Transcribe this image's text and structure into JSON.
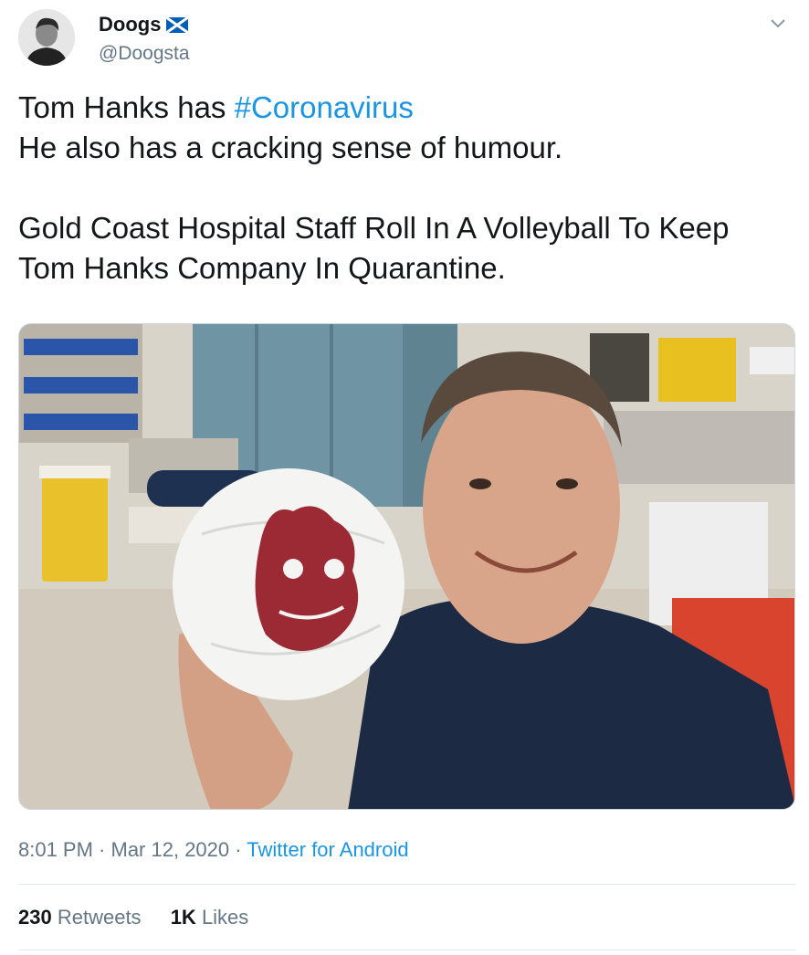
{
  "user": {
    "display_name": "Doogs",
    "handle": "@Doogsta",
    "flag_icon": "scotland-flag-icon"
  },
  "menu_icon": "chevron-down-icon",
  "tweet": {
    "line1_text": "Tom Hanks has ",
    "line1_hashtag": "#Coronavirus",
    "line2": "He also has a cracking sense of humour.",
    "line3": "Gold Coast Hospital Staff Roll In A Volleyball To Keep",
    "line4": "Tom Hanks Company In Quarantine."
  },
  "meta": {
    "time": "8:01 PM",
    "sep1": " · ",
    "date": "Mar 12, 2020",
    "sep2": " · ",
    "source": "Twitter for Android"
  },
  "stats": {
    "retweets_count": "230",
    "retweets_label": "Retweets",
    "likes_count": "1K",
    "likes_label": "Likes"
  },
  "colors": {
    "link": "#1b95e0",
    "secondary_text": "#657786",
    "flag_blue": "#005eb8"
  }
}
